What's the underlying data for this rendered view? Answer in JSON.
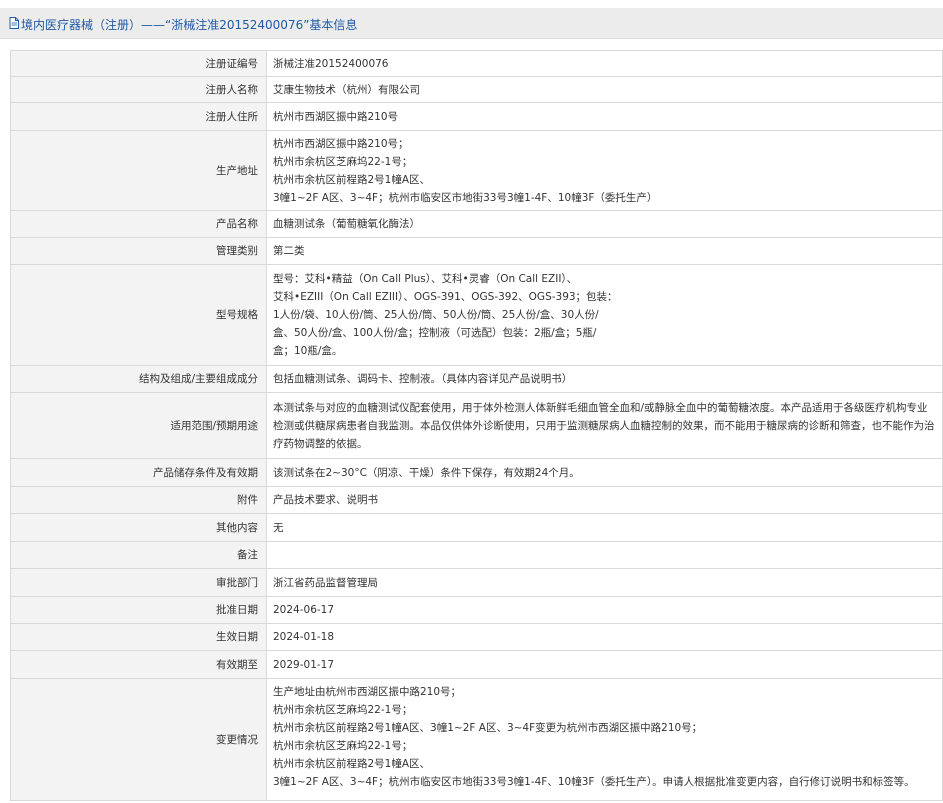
{
  "header": {
    "title": "境内医疗器械（注册）——“浙械注准20152400076”基本信息",
    "icon": "document-icon",
    "color": "#1f5aa6"
  },
  "rows": [
    {
      "label": "注册证编号",
      "lines": [
        "浙械注准20152400076"
      ]
    },
    {
      "label": "注册人名称",
      "lines": [
        "艾康生物技术（杭州）有限公司"
      ]
    },
    {
      "label": "注册人住所",
      "lines": [
        "杭州市西湖区振中路210号"
      ]
    },
    {
      "label": "生产地址",
      "lines": [
        "杭州市西湖区振中路210号；",
        "杭州市余杭区芝麻坞22-1号；",
        "杭州市余杭区前程路2号1幢A区、",
        "3幢1~2F A区、3~4F；杭州市临安区市地街33号3幢1-4F、10幢3F（委托生产）"
      ]
    },
    {
      "label": "产品名称",
      "lines": [
        "血糖测试条（葡萄糖氧化酶法）"
      ]
    },
    {
      "label": "管理类别",
      "lines": [
        "第二类"
      ]
    },
    {
      "label": "型号规格",
      "lines": [
        "型号：艾科•精益（On Call Plus）、艾科•灵睿（On Call EZII）、",
        "艾科•EZIII（On Call EZIII）、OGS-391、OGS-392、OGS-393；包装：",
        "1人份/袋、10人份/筒、25人份/筒、50人份/筒、25人份/盒、30人份/",
        "盒、50人份/盒、100人份/盒；控制液（可选配）包装：2瓶/盒；5瓶/",
        "盒；10瓶/盒。"
      ]
    },
    {
      "label": "结构及组成/主要组成成分",
      "lines": [
        "包括血糖测试条、调码卡、控制液。（具体内容详见产品说明书）"
      ]
    },
    {
      "label": "适用范围/预期用途",
      "lines": [
        "本测试条与对应的血糖测试仪配套使用，用于体外检测人体新鲜毛细血管全血和/或静脉全血中的葡萄糖浓度。本产品适用于各级医疗机构专业检测或供糖尿病患者自我监测。本品仅供体外诊断使用，只用于监测糖尿病人血糖控制的效果，而不能用于糖尿病的诊断和筛查，也不能作为治疗药物调整的依据。"
      ],
      "wrap": true
    },
    {
      "label": "产品储存条件及有效期",
      "lines": [
        "该测试条在2~30°C（阴凉、干燥）条件下保存，有效期24个月。"
      ]
    },
    {
      "label": "附件",
      "lines": [
        "产品技术要求、说明书"
      ]
    },
    {
      "label": "其他内容",
      "lines": [
        "无"
      ]
    },
    {
      "label": "备注",
      "lines": [
        ""
      ]
    },
    {
      "label": "审批部门",
      "lines": [
        "浙江省药品监督管理局"
      ]
    },
    {
      "label": "批准日期",
      "lines": [
        "2024-06-17"
      ]
    },
    {
      "label": "生效日期",
      "lines": [
        "2024-01-18"
      ]
    },
    {
      "label": "有效期至",
      "lines": [
        "2029-01-17"
      ]
    },
    {
      "label": "变更情况",
      "lines": [
        "生产地址由杭州市西湖区振中路210号；",
        "杭州市余杭区芝麻坞22-1号；",
        "杭州市余杭区前程路2号1幢A区、3幢1~2F A区、3~4F变更为杭州市西湖区振中路210号；",
        "杭州市余杭区芝麻坞22-1号；",
        "杭州市余杭区前程路2号1幢A区、",
        "3幢1~2F A区、3~4F；杭州市临安区市地街33号3幢1-4F、10幢3F（委托生产）。申请人根据批准变更内容，自行修订说明书和标签等。"
      ]
    }
  ]
}
